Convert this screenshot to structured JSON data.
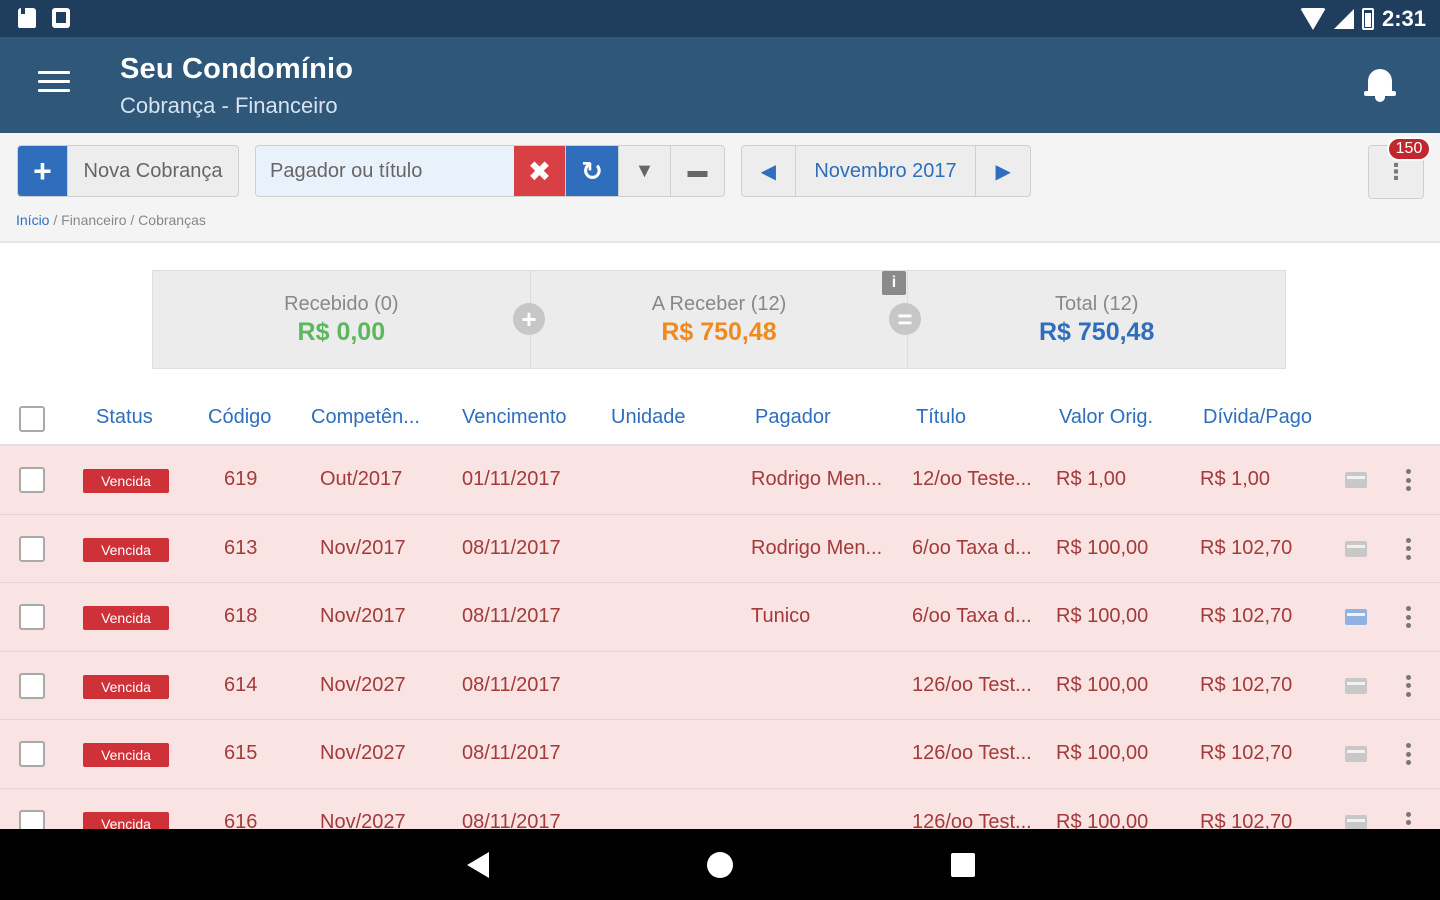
{
  "status_bar": {
    "time": "2:31"
  },
  "app_bar": {
    "title": "Seu Condomínio",
    "subtitle": "Cobrança - Financeiro"
  },
  "toolbar": {
    "new_charge_label": "Nova Cobrança",
    "search_placeholder": "Pagador ou título",
    "month_label": "Novembro 2017",
    "badge_count": "150"
  },
  "breadcrumb": {
    "home": "Início",
    "rest": " / Financeiro / Cobranças"
  },
  "summary": {
    "received": {
      "label": "Recebido (0)",
      "value": "R$ 0,00"
    },
    "to_receive": {
      "label": "A Receber (12)",
      "value": "R$ 750,48"
    },
    "total": {
      "label": "Total (12)",
      "value": "R$ 750,48"
    }
  },
  "table": {
    "headers": [
      "Status",
      "Código",
      "Competên...",
      "Vencimento",
      "Unidade",
      "Pagador",
      "Título",
      "Valor Orig.",
      "Dívida/Pago"
    ],
    "rows": [
      {
        "status": "Vencida",
        "code": "619",
        "competence": "Out/2017",
        "due": "01/11/2017",
        "unit": "",
        "payer": "Rodrigo Men...",
        "title": "12/oo Teste...",
        "orig": "R$ 1,00",
        "debt": "R$ 1,00",
        "card_highlight": false
      },
      {
        "status": "Vencida",
        "code": "613",
        "competence": "Nov/2017",
        "due": "08/11/2017",
        "unit": "",
        "payer": "Rodrigo Men...",
        "title": "6/oo Taxa d...",
        "orig": "R$ 100,00",
        "debt": "R$ 102,70",
        "card_highlight": false
      },
      {
        "status": "Vencida",
        "code": "618",
        "competence": "Nov/2017",
        "due": "08/11/2017",
        "unit": "",
        "payer": "Tunico",
        "title": "6/oo Taxa d...",
        "orig": "R$ 100,00",
        "debt": "R$ 102,70",
        "card_highlight": true
      },
      {
        "status": "Vencida",
        "code": "614",
        "competence": "Nov/2027",
        "due": "08/11/2017",
        "unit": "",
        "payer": "",
        "title": "126/oo Test...",
        "orig": "R$ 100,00",
        "debt": "R$ 102,70",
        "card_highlight": false
      },
      {
        "status": "Vencida",
        "code": "615",
        "competence": "Nov/2027",
        "due": "08/11/2017",
        "unit": "",
        "payer": "",
        "title": "126/oo Test...",
        "orig": "R$ 100,00",
        "debt": "R$ 102,70",
        "card_highlight": false
      },
      {
        "status": "Vencida",
        "code": "616",
        "competence": "Nov/2027",
        "due": "08/11/2017",
        "unit": "",
        "payer": "",
        "title": "126/oo Test...",
        "orig": "R$ 100,00",
        "debt": "R$ 102,70",
        "card_highlight": false
      }
    ]
  },
  "colors": {
    "status_bar": "#1f3d5d",
    "app_bar": "#2e5779",
    "primary_blue": "#2f6ebc",
    "danger_red": "#d94045",
    "overdue_row": "#f9e3e3",
    "received_green": "#5cb85c",
    "to_receive_orange": "#f08a1e"
  }
}
